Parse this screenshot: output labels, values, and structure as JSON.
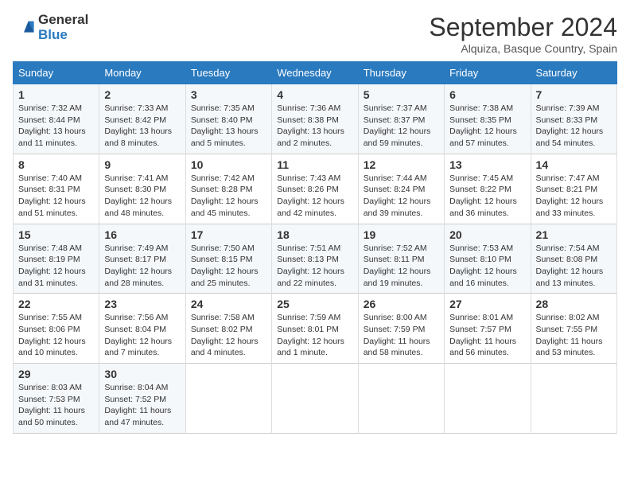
{
  "logo": {
    "line1": "General",
    "line2": "Blue"
  },
  "title": "September 2024",
  "location": "Alquiza, Basque Country, Spain",
  "days_of_week": [
    "Sunday",
    "Monday",
    "Tuesday",
    "Wednesday",
    "Thursday",
    "Friday",
    "Saturday"
  ],
  "weeks": [
    [
      {
        "day": "1",
        "sunrise": "7:32 AM",
        "sunset": "8:44 PM",
        "daylight": "13 hours and 11 minutes."
      },
      {
        "day": "2",
        "sunrise": "7:33 AM",
        "sunset": "8:42 PM",
        "daylight": "13 hours and 8 minutes."
      },
      {
        "day": "3",
        "sunrise": "7:35 AM",
        "sunset": "8:40 PM",
        "daylight": "13 hours and 5 minutes."
      },
      {
        "day": "4",
        "sunrise": "7:36 AM",
        "sunset": "8:38 PM",
        "daylight": "13 hours and 2 minutes."
      },
      {
        "day": "5",
        "sunrise": "7:37 AM",
        "sunset": "8:37 PM",
        "daylight": "12 hours and 59 minutes."
      },
      {
        "day": "6",
        "sunrise": "7:38 AM",
        "sunset": "8:35 PM",
        "daylight": "12 hours and 57 minutes."
      },
      {
        "day": "7",
        "sunrise": "7:39 AM",
        "sunset": "8:33 PM",
        "daylight": "12 hours and 54 minutes."
      }
    ],
    [
      {
        "day": "8",
        "sunrise": "7:40 AM",
        "sunset": "8:31 PM",
        "daylight": "12 hours and 51 minutes."
      },
      {
        "day": "9",
        "sunrise": "7:41 AM",
        "sunset": "8:30 PM",
        "daylight": "12 hours and 48 minutes."
      },
      {
        "day": "10",
        "sunrise": "7:42 AM",
        "sunset": "8:28 PM",
        "daylight": "12 hours and 45 minutes."
      },
      {
        "day": "11",
        "sunrise": "7:43 AM",
        "sunset": "8:26 PM",
        "daylight": "12 hours and 42 minutes."
      },
      {
        "day": "12",
        "sunrise": "7:44 AM",
        "sunset": "8:24 PM",
        "daylight": "12 hours and 39 minutes."
      },
      {
        "day": "13",
        "sunrise": "7:45 AM",
        "sunset": "8:22 PM",
        "daylight": "12 hours and 36 minutes."
      },
      {
        "day": "14",
        "sunrise": "7:47 AM",
        "sunset": "8:21 PM",
        "daylight": "12 hours and 33 minutes."
      }
    ],
    [
      {
        "day": "15",
        "sunrise": "7:48 AM",
        "sunset": "8:19 PM",
        "daylight": "12 hours and 31 minutes."
      },
      {
        "day": "16",
        "sunrise": "7:49 AM",
        "sunset": "8:17 PM",
        "daylight": "12 hours and 28 minutes."
      },
      {
        "day": "17",
        "sunrise": "7:50 AM",
        "sunset": "8:15 PM",
        "daylight": "12 hours and 25 minutes."
      },
      {
        "day": "18",
        "sunrise": "7:51 AM",
        "sunset": "8:13 PM",
        "daylight": "12 hours and 22 minutes."
      },
      {
        "day": "19",
        "sunrise": "7:52 AM",
        "sunset": "8:11 PM",
        "daylight": "12 hours and 19 minutes."
      },
      {
        "day": "20",
        "sunrise": "7:53 AM",
        "sunset": "8:10 PM",
        "daylight": "12 hours and 16 minutes."
      },
      {
        "day": "21",
        "sunrise": "7:54 AM",
        "sunset": "8:08 PM",
        "daylight": "12 hours and 13 minutes."
      }
    ],
    [
      {
        "day": "22",
        "sunrise": "7:55 AM",
        "sunset": "8:06 PM",
        "daylight": "12 hours and 10 minutes."
      },
      {
        "day": "23",
        "sunrise": "7:56 AM",
        "sunset": "8:04 PM",
        "daylight": "12 hours and 7 minutes."
      },
      {
        "day": "24",
        "sunrise": "7:58 AM",
        "sunset": "8:02 PM",
        "daylight": "12 hours and 4 minutes."
      },
      {
        "day": "25",
        "sunrise": "7:59 AM",
        "sunset": "8:01 PM",
        "daylight": "12 hours and 1 minute."
      },
      {
        "day": "26",
        "sunrise": "8:00 AM",
        "sunset": "7:59 PM",
        "daylight": "11 hours and 58 minutes."
      },
      {
        "day": "27",
        "sunrise": "8:01 AM",
        "sunset": "7:57 PM",
        "daylight": "11 hours and 56 minutes."
      },
      {
        "day": "28",
        "sunrise": "8:02 AM",
        "sunset": "7:55 PM",
        "daylight": "11 hours and 53 minutes."
      }
    ],
    [
      {
        "day": "29",
        "sunrise": "8:03 AM",
        "sunset": "7:53 PM",
        "daylight": "11 hours and 50 minutes."
      },
      {
        "day": "30",
        "sunrise": "8:04 AM",
        "sunset": "7:52 PM",
        "daylight": "11 hours and 47 minutes."
      },
      null,
      null,
      null,
      null,
      null
    ]
  ]
}
